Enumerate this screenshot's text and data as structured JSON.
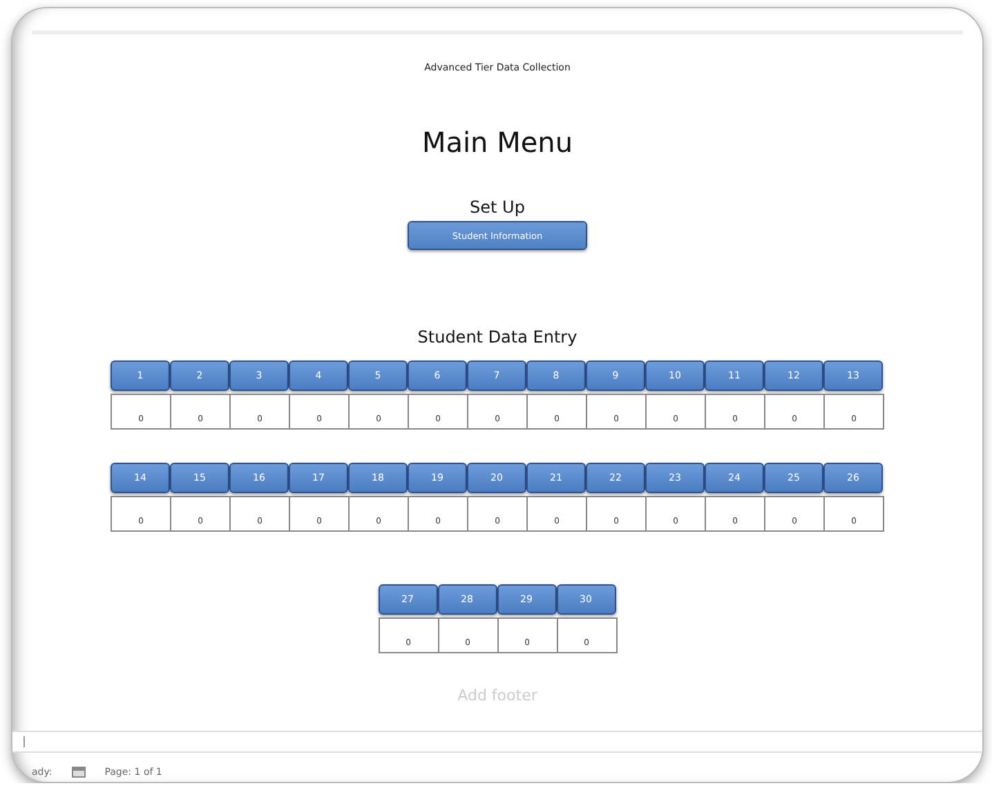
{
  "page": {
    "header": "Advanced Tier Data Collection",
    "title": "Main Menu"
  },
  "setup": {
    "heading": "Set Up",
    "button": "Student Information"
  },
  "data_entry": {
    "heading": "Student Data Entry",
    "rows": [
      {
        "students": [
          {
            "label": "1",
            "count": "0"
          },
          {
            "label": "2",
            "count": "0"
          },
          {
            "label": "3",
            "count": "0"
          },
          {
            "label": "4",
            "count": "0"
          },
          {
            "label": "5",
            "count": "0"
          },
          {
            "label": "6",
            "count": "0"
          },
          {
            "label": "7",
            "count": "0"
          },
          {
            "label": "8",
            "count": "0"
          },
          {
            "label": "9",
            "count": "0"
          },
          {
            "label": "10",
            "count": "0"
          },
          {
            "label": "11",
            "count": "0"
          },
          {
            "label": "12",
            "count": "0"
          },
          {
            "label": "13",
            "count": "0"
          }
        ]
      },
      {
        "students": [
          {
            "label": "14",
            "count": "0"
          },
          {
            "label": "15",
            "count": "0"
          },
          {
            "label": "16",
            "count": "0"
          },
          {
            "label": "17",
            "count": "0"
          },
          {
            "label": "18",
            "count": "0"
          },
          {
            "label": "19",
            "count": "0"
          },
          {
            "label": "20",
            "count": "0"
          },
          {
            "label": "21",
            "count": "0"
          },
          {
            "label": "22",
            "count": "0"
          },
          {
            "label": "23",
            "count": "0"
          },
          {
            "label": "24",
            "count": "0"
          },
          {
            "label": "25",
            "count": "0"
          },
          {
            "label": "26",
            "count": "0"
          }
        ]
      },
      {
        "students": [
          {
            "label": "27",
            "count": "0"
          },
          {
            "label": "28",
            "count": "0"
          },
          {
            "label": "29",
            "count": "0"
          },
          {
            "label": "30",
            "count": "0"
          }
        ]
      }
    ]
  },
  "footer": {
    "placeholder": "Add footer"
  },
  "status_bar": {
    "mode": "ady:",
    "page": "Page: 1 of 1"
  }
}
